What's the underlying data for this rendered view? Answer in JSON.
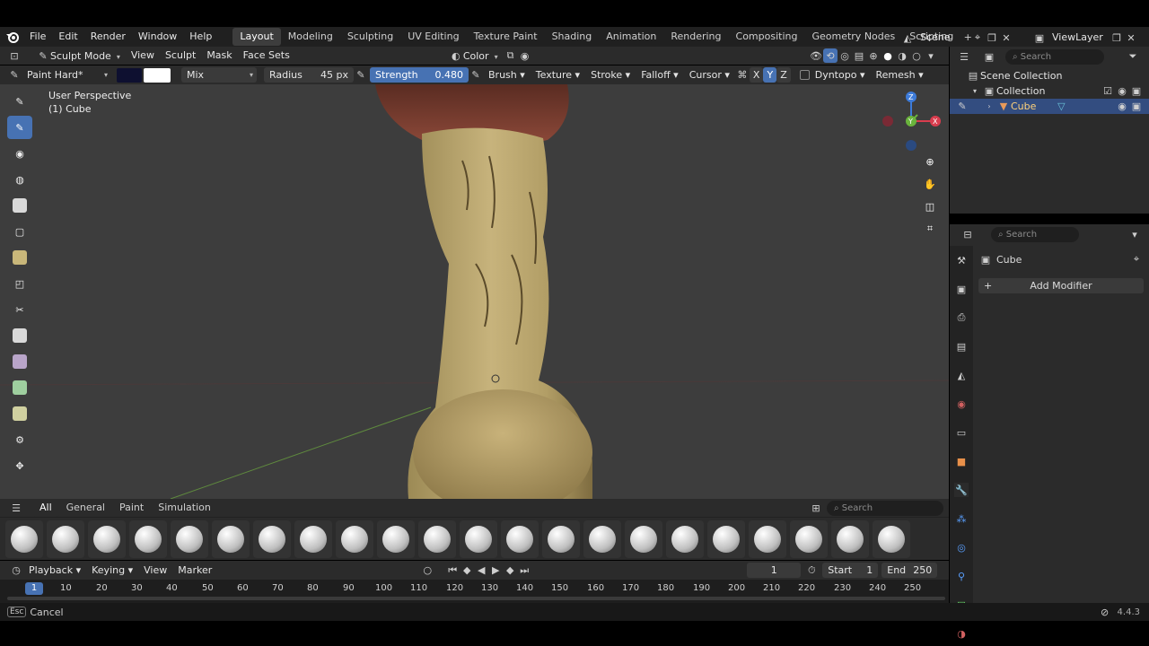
{
  "topbar": {
    "menus": [
      "File",
      "Edit",
      "Render",
      "Window",
      "Help"
    ],
    "workspaces": [
      "Layout",
      "Modeling",
      "Sculpting",
      "UV Editing",
      "Texture Paint",
      "Shading",
      "Animation",
      "Rendering",
      "Compositing",
      "Geometry Nodes",
      "Scripting"
    ],
    "active_workspace": "Layout",
    "scene": "Scene",
    "view_layer": "ViewLayer"
  },
  "header": {
    "mode": "Sculpt Mode",
    "menus": [
      "View",
      "Sculpt",
      "Mask",
      "Face Sets"
    ],
    "color_label": "Color",
    "brush_name": "Paint Hard*",
    "blend": "Mix",
    "radius_label": "Radius",
    "radius_value": "45 px",
    "strength_label": "Strength",
    "strength_value": "0.480",
    "dropdowns": [
      "Brush",
      "Texture",
      "Stroke",
      "Falloff",
      "Cursor"
    ],
    "axes": [
      "X",
      "Y",
      "Z"
    ],
    "dyntopo": "Dyntopo",
    "remesh": "Remesh"
  },
  "viewport": {
    "perspective": "User Perspective",
    "object": "(1) Cube",
    "gizmo_axes": [
      "X",
      "Y",
      "Z"
    ]
  },
  "shelf": {
    "tabs": [
      "All",
      "General",
      "Paint",
      "Simulation"
    ],
    "search_placeholder": "Search"
  },
  "timeline": {
    "menus": [
      "Playback",
      "Keying",
      "View",
      "Marker"
    ],
    "current_frame": "1",
    "start_label": "Start",
    "start": "1",
    "end_label": "End",
    "end": "250",
    "ticks": [
      "1",
      "10",
      "20",
      "30",
      "40",
      "50",
      "60",
      "70",
      "80",
      "90",
      "100",
      "110",
      "120",
      "130",
      "140",
      "150",
      "160",
      "170",
      "180",
      "190",
      "200",
      "210",
      "220",
      "230",
      "240",
      "250"
    ]
  },
  "outliner": {
    "search_placeholder": "Search",
    "root": "Scene Collection",
    "collection": "Collection",
    "object": "Cube"
  },
  "properties": {
    "search_placeholder": "Search",
    "object": "Cube",
    "add_modifier": "Add Modifier"
  },
  "statusbar": {
    "key": "Esc",
    "action": "Cancel",
    "version": "4.4.3"
  },
  "colors": {
    "accent": "#4772b3",
    "viewport_bg": "#3d3d3d",
    "panel_bg": "#2b2b2b"
  }
}
